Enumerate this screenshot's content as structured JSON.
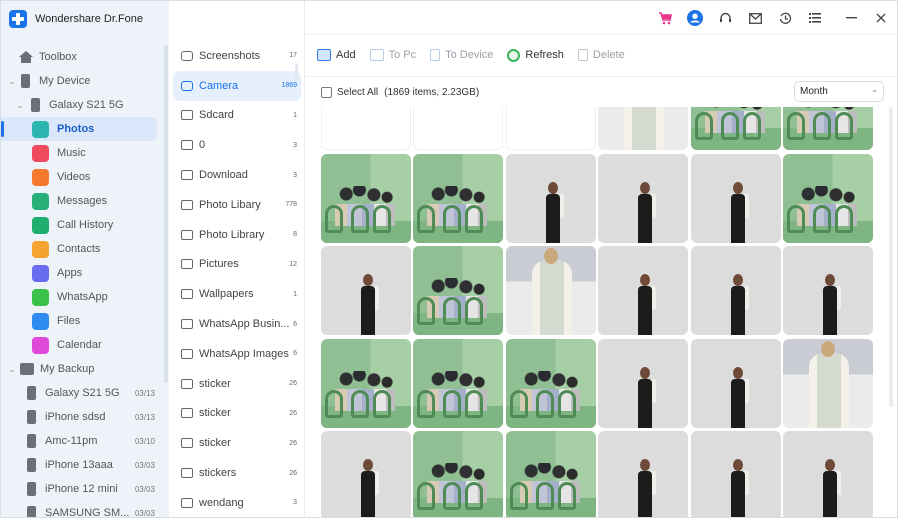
{
  "app": {
    "title": "Wondershare Dr.Fone"
  },
  "sidebar": {
    "toolbox": "Toolbox",
    "my_device": "My Device",
    "device_name": "Galaxy S21 5G",
    "apps": [
      {
        "label": "Photos",
        "icon": "photos-icon",
        "color": "#2bb5b0",
        "active": true
      },
      {
        "label": "Music",
        "icon": "music-icon",
        "color": "#ef4a5d"
      },
      {
        "label": "Videos",
        "icon": "videos-icon",
        "color": "#f7792e"
      },
      {
        "label": "Messages",
        "icon": "messages-icon",
        "color": "#27b07a"
      },
      {
        "label": "Call History",
        "icon": "call-history-icon",
        "color": "#1fae70"
      },
      {
        "label": "Contacts",
        "icon": "contacts-icon",
        "color": "#f5a231"
      },
      {
        "label": "Apps",
        "icon": "apps-icon",
        "color": "#6a6cf0"
      },
      {
        "label": "WhatsApp",
        "icon": "whatsapp-icon",
        "color": "#3cc24a"
      },
      {
        "label": "Files",
        "icon": "files-icon",
        "color": "#2e8cf0"
      },
      {
        "label": "Calendar",
        "icon": "calendar-icon",
        "color": "#e04ad8"
      }
    ],
    "my_backup": "My Backup",
    "backups": [
      {
        "name": "Galaxy S21 5G",
        "date": "03/13"
      },
      {
        "name": "iPhone  sdsd",
        "date": "03/13"
      },
      {
        "name": "Amc-11pm",
        "date": "03/10"
      },
      {
        "name": "iPhone 13aaa",
        "date": "03/03"
      },
      {
        "name": "iPhone 12 mini",
        "date": "03/03"
      },
      {
        "name": "SAMSUNG SM...",
        "date": "03/03"
      }
    ]
  },
  "albums": [
    {
      "name": "Screenshots",
      "count": "17",
      "icon": "camera-icon"
    },
    {
      "name": "Camera",
      "count": "1869",
      "icon": "camera-icon",
      "active": true
    },
    {
      "name": "Sdcard",
      "count": "1",
      "icon": "image-icon"
    },
    {
      "name": "0",
      "count": "3",
      "icon": "image-icon"
    },
    {
      "name": "Download",
      "count": "3",
      "icon": "image-icon"
    },
    {
      "name": "Photo Libary",
      "count": "778",
      "icon": "image-icon"
    },
    {
      "name": "Photo Library",
      "count": "8",
      "icon": "image-icon"
    },
    {
      "name": "Pictures",
      "count": "12",
      "icon": "image-icon"
    },
    {
      "name": "Wallpapers",
      "count": "1",
      "icon": "image-icon"
    },
    {
      "name": "WhatsApp Busin...",
      "count": "6",
      "icon": "image-icon"
    },
    {
      "name": "WhatsApp Images",
      "count": "6",
      "icon": "image-icon"
    },
    {
      "name": "sticker",
      "count": "26",
      "icon": "image-icon"
    },
    {
      "name": "sticker",
      "count": "26",
      "icon": "image-icon"
    },
    {
      "name": "sticker",
      "count": "26",
      "icon": "image-icon"
    },
    {
      "name": "stickers",
      "count": "26",
      "icon": "image-icon"
    },
    {
      "name": "wendang",
      "count": "3",
      "icon": "image-icon"
    }
  ],
  "topbar": {
    "icons": [
      "cart-icon",
      "account-icon",
      "support-icon",
      "mail-icon",
      "history-icon",
      "menu-icon",
      "minimize-icon",
      "close-icon"
    ],
    "cart_color": "#e9358c",
    "account_color": "#1a73e8"
  },
  "toolbar": {
    "add": "Add",
    "to_pc": "To Pc",
    "to_device": "To Device",
    "refresh": "Refresh",
    "delete": "Delete"
  },
  "selection": {
    "select_all": "Select All",
    "summary": "(1869 items, 2.23GB)"
  },
  "filter": {
    "selected": "Month"
  },
  "photos": {
    "rows": [
      [
        "blank",
        "blank",
        "blank",
        "lady",
        "green",
        "green"
      ],
      [
        "green",
        "green",
        "grey",
        "grey",
        "grey",
        "green"
      ],
      [
        "grey",
        "green",
        "lady",
        "grey",
        "grey",
        "grey"
      ],
      [
        "green",
        "green",
        "green",
        "grey",
        "grey",
        "lady"
      ],
      [
        "grey",
        "green",
        "green",
        "grey",
        "grey",
        "grey"
      ]
    ]
  }
}
